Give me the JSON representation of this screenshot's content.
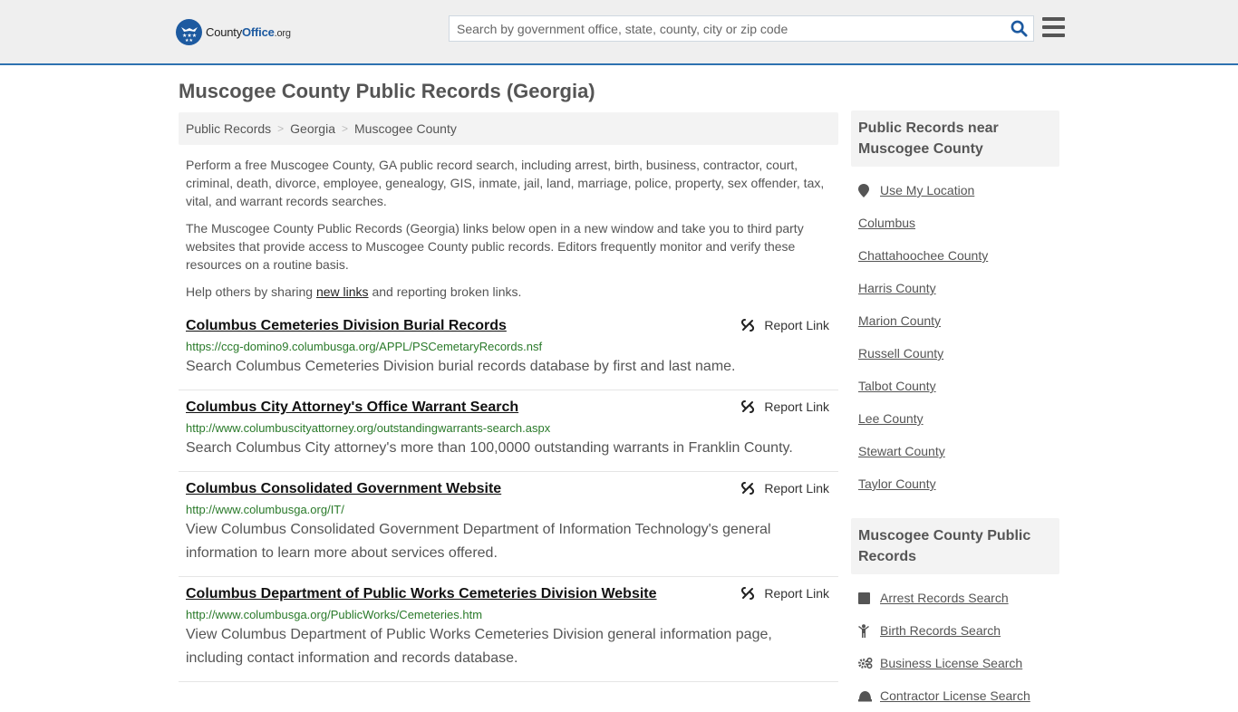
{
  "header": {
    "logo": {
      "name": "County",
      "office": "Office",
      "tld": ".org"
    },
    "search": {
      "placeholder": "Search by government office, state, county, city or zip code",
      "value": ""
    },
    "colors": {
      "accent": "#2e72b0",
      "brand": "#1d5aa0",
      "url_green": "#2a7a2a"
    }
  },
  "page": {
    "title": "Muscogee County Public Records (Georgia)"
  },
  "breadcrumb": [
    {
      "label": "Public Records"
    },
    {
      "label": "Georgia"
    },
    {
      "label": "Muscogee County"
    }
  ],
  "intro": {
    "p1": "Perform a free Muscogee County, GA public record search, including arrest, birth, business, contractor, court, criminal, death, divorce, employee, genealogy, GIS, inmate, jail, land, marriage, police, property, sex offender, tax, vital, and warrant records searches.",
    "p2": "The Muscogee County Public Records (Georgia) links below open in a new window and take you to third party websites that provide access to Muscogee County public records. Editors frequently monitor and verify these resources on a routine basis.",
    "p3_before": "Help others by sharing ",
    "p3_link": "new links",
    "p3_after": " and reporting broken links."
  },
  "results": [
    {
      "title": "Columbus Cemeteries Division Burial Records",
      "url": "https://ccg-domino9.columbusga.org/APPL/PSCemetaryRecords.nsf",
      "description": "Search Columbus Cemeteries Division burial records database by first and last name.",
      "report_label": "Report Link"
    },
    {
      "title": "Columbus City Attorney's Office Warrant Search",
      "url": "http://www.columbuscityattorney.org/outstandingwarrants-search.aspx",
      "description": "Search Columbus City attorney's more than 100,0000 outstanding warrants in Franklin County.",
      "report_label": "Report Link"
    },
    {
      "title": "Columbus Consolidated Government Website",
      "url": "http://www.columbusga.org/IT/",
      "description": "View Columbus Consolidated Government Department of Information Technology's general information to learn more about services offered.",
      "report_label": "Report Link"
    },
    {
      "title": "Columbus Department of Public Works Cemeteries Division Website",
      "url": "http://www.columbusga.org/PublicWorks/Cemeteries.htm",
      "description": "View Columbus Department of Public Works Cemeteries Division general information page, including contact information and records database.",
      "report_label": "Report Link"
    }
  ],
  "sidebar": {
    "nearby": {
      "heading": "Public Records near Muscogee County",
      "use_location": "Use My Location",
      "items": [
        {
          "label": "Columbus"
        },
        {
          "label": "Chattahoochee County"
        },
        {
          "label": "Harris County"
        },
        {
          "label": "Marion County"
        },
        {
          "label": "Russell County"
        },
        {
          "label": "Talbot County"
        },
        {
          "label": "Lee County"
        },
        {
          "label": "Stewart County"
        },
        {
          "label": "Taylor County"
        }
      ]
    },
    "records": {
      "heading": "Muscogee County Public Records",
      "items": [
        {
          "label": "Arrest Records Search",
          "icon": "square-icon"
        },
        {
          "label": "Birth Records Search",
          "icon": "child-icon"
        },
        {
          "label": "Business License Search",
          "icon": "cogs-icon"
        },
        {
          "label": "Contractor License Search",
          "icon": "hard-hat-icon"
        }
      ]
    }
  }
}
